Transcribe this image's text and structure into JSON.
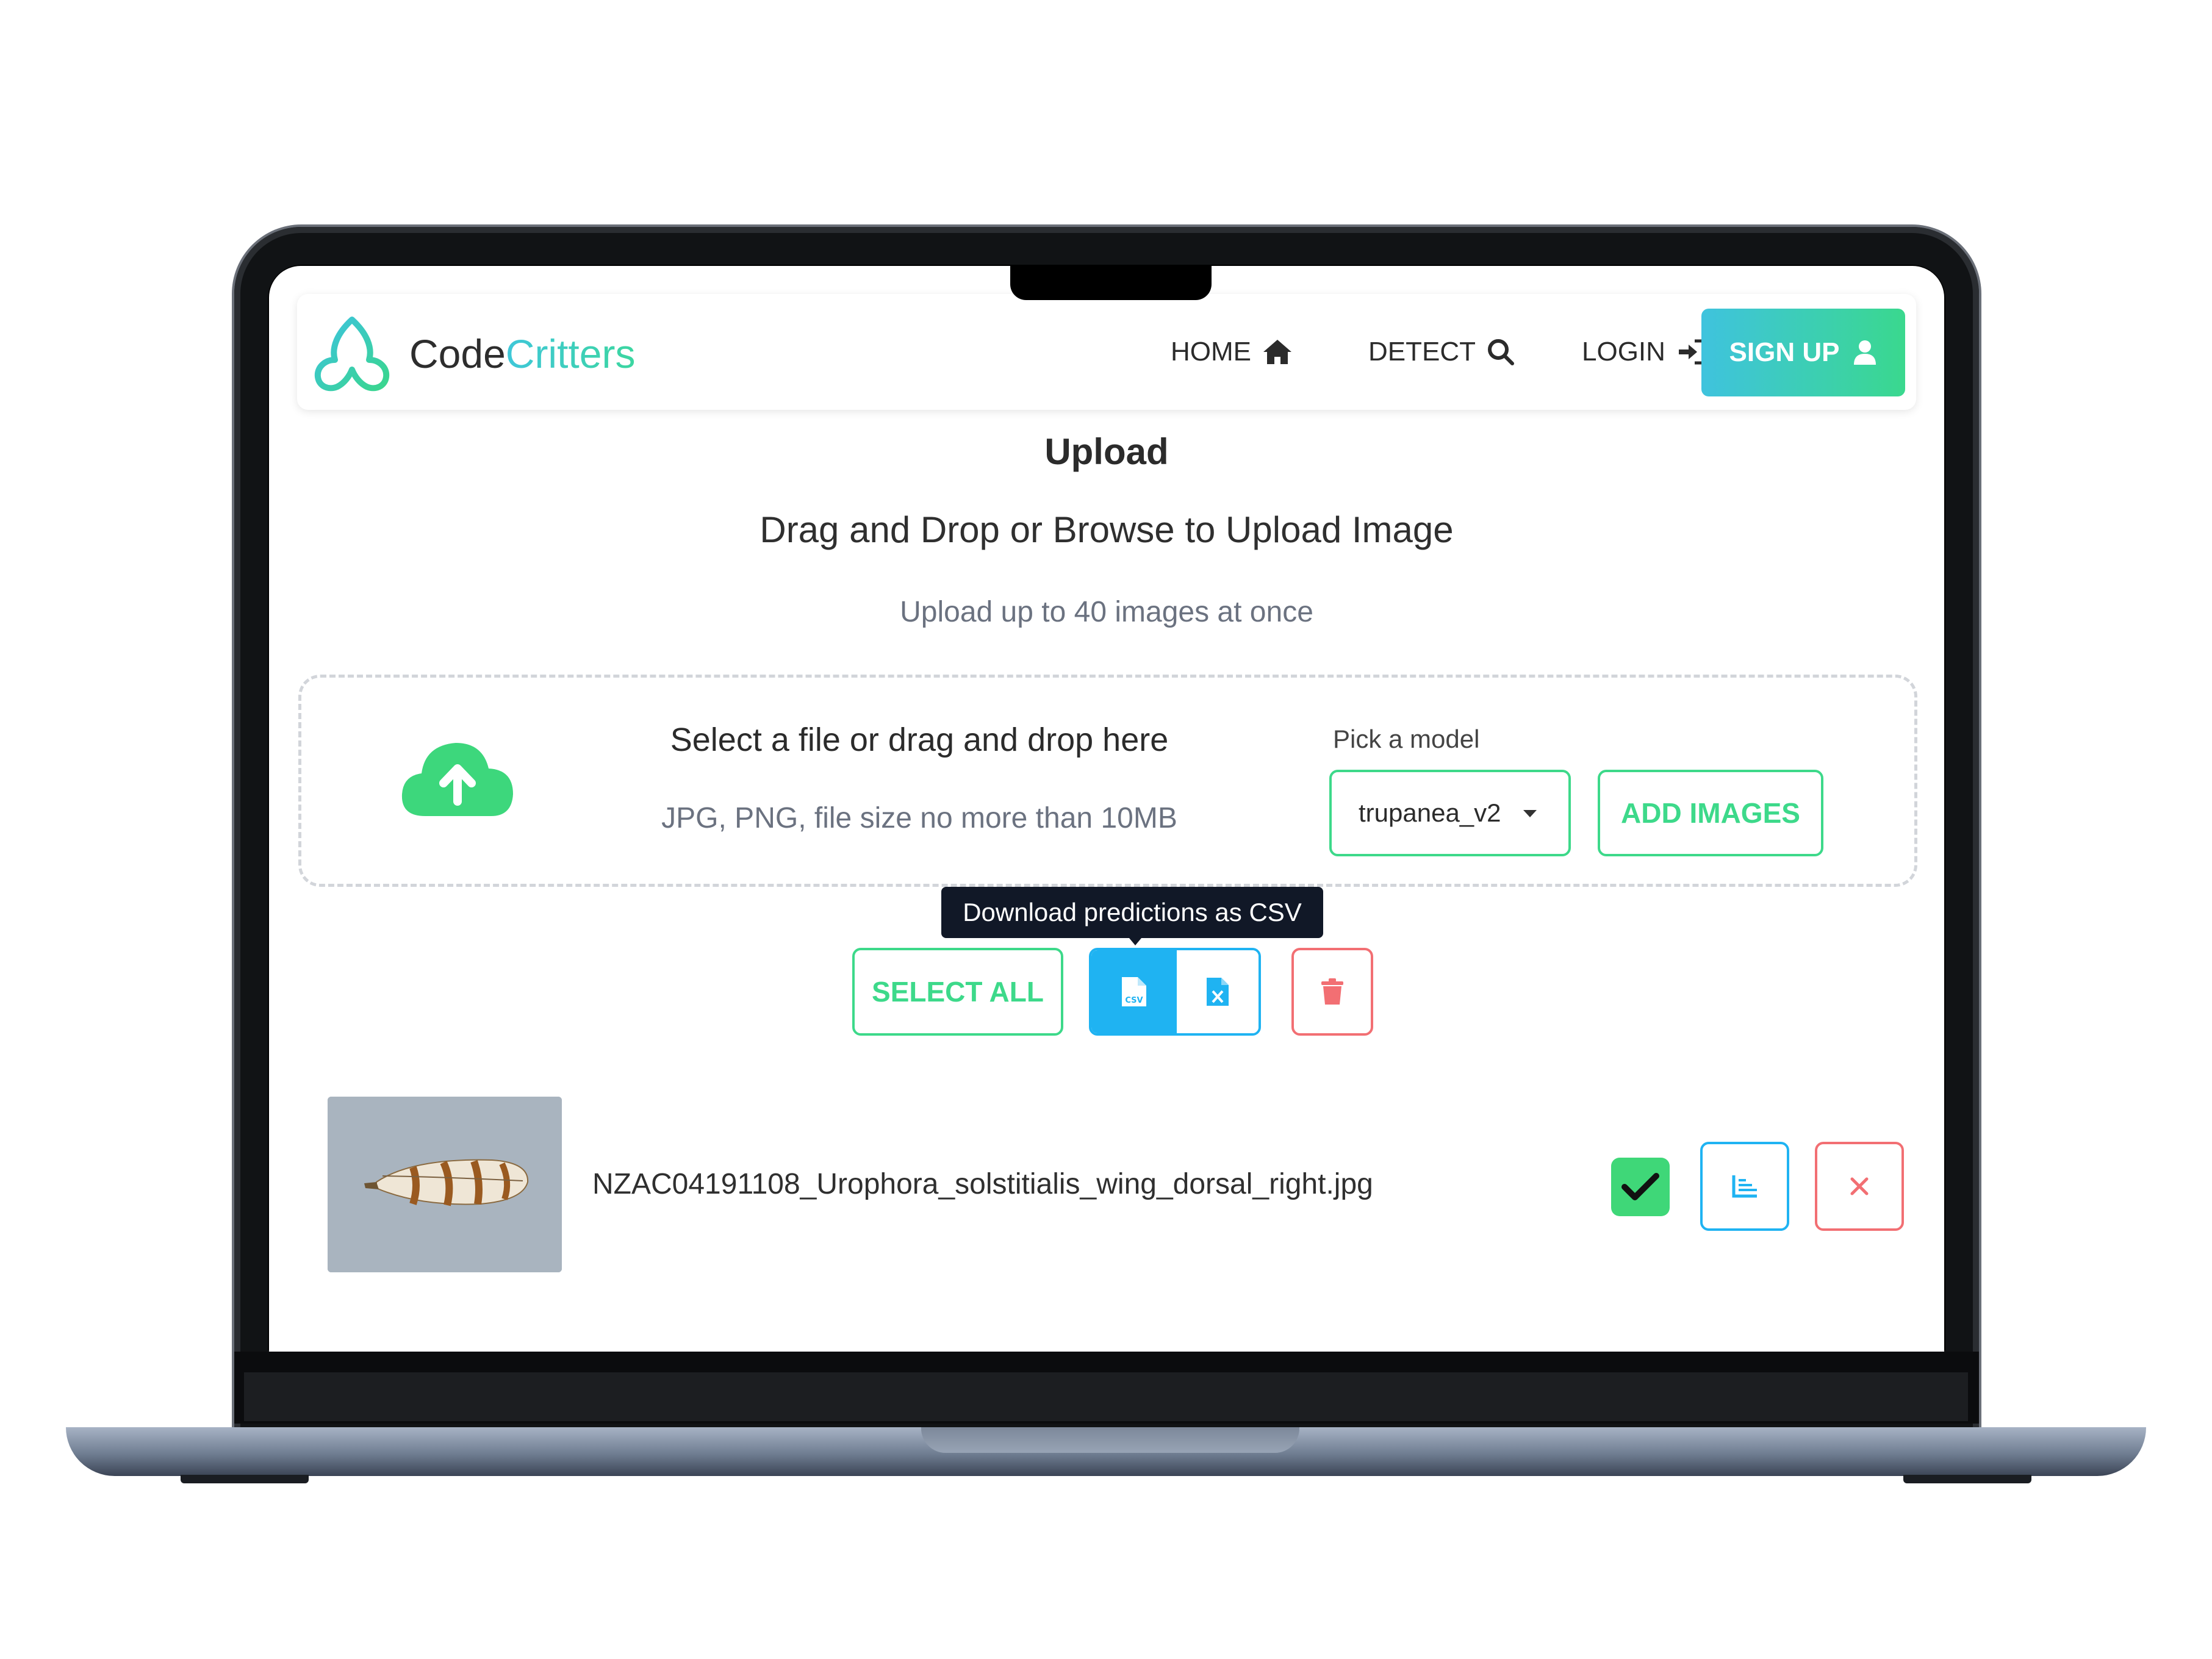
{
  "brand": {
    "name_part1": "Code",
    "name_part2": "Critters"
  },
  "nav": {
    "home": "HOME",
    "detect": "DETECT",
    "login": "LOGIN",
    "signup": "SIGN UP"
  },
  "upload": {
    "title": "Upload",
    "subtitle": "Drag and Drop or Browse to Upload Image",
    "limit_note": "Upload up to 40 images at once"
  },
  "dropzone": {
    "title": "Select a file or drag and drop here",
    "note": "JPG, PNG, file size no more than 10MB",
    "model_label": "Pick a model",
    "model_selected": "trupanea_v2",
    "add_images": "ADD IMAGES"
  },
  "toolbar": {
    "select_all": "SELECT ALL",
    "tooltip": "Download predictions as CSV",
    "csv_icon": "csv-file-icon",
    "excel_icon": "excel-file-icon",
    "delete_icon": "trash-icon"
  },
  "files": [
    {
      "name": "NZAC04191108_Urophora_solstitialis_wing_dorsal_right.jpg",
      "selected": true
    }
  ],
  "colors": {
    "accent_green": "#3dd98a",
    "accent_blue": "#1fb3f2",
    "danger": "#f26f73",
    "tooltip_bg": "#111827"
  }
}
